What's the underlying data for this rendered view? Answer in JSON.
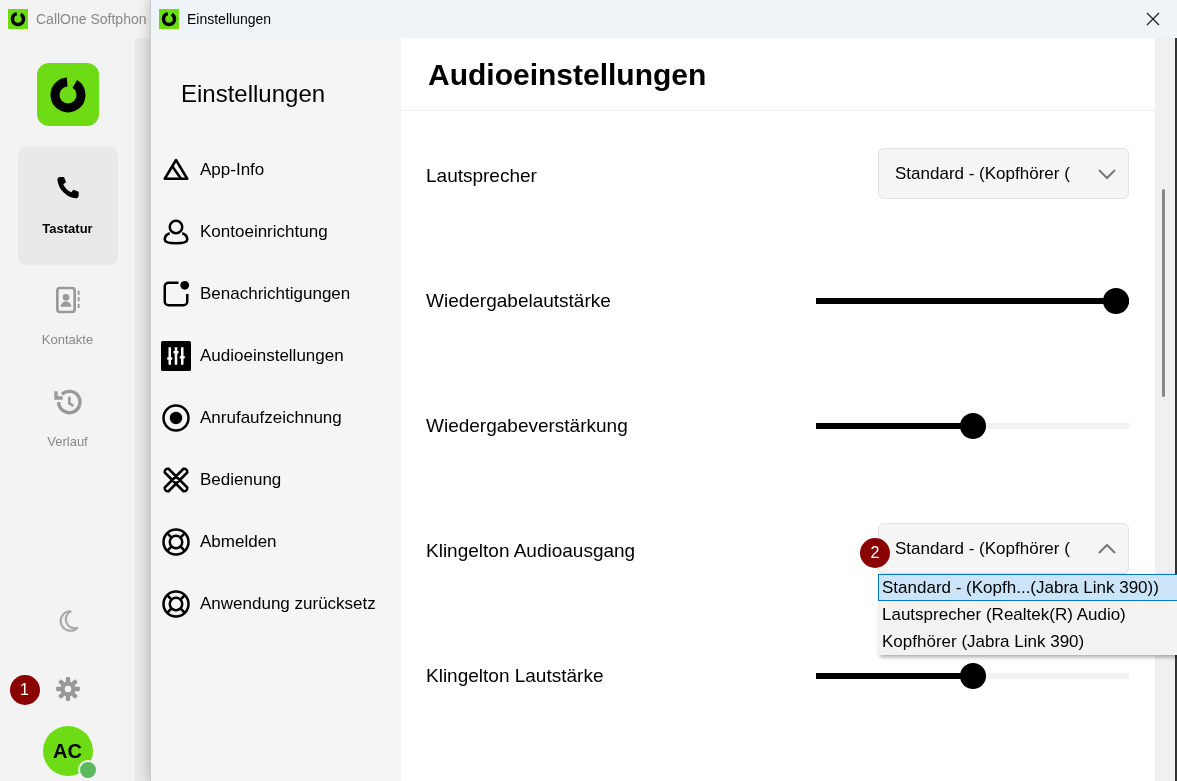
{
  "app_window": {
    "title": "CallOne Softphon",
    "nav": [
      {
        "label": "Tastatur",
        "selected": true
      },
      {
        "label": "Kontakte",
        "selected": false
      },
      {
        "label": "Verlauf",
        "selected": false
      }
    ],
    "settings_badge": "1",
    "avatar": {
      "initials": "AC"
    },
    "status_dot": {
      "color": "#5cb85c"
    }
  },
  "dialog": {
    "title": "Einstellungen",
    "sidebar": {
      "heading": "Einstellungen",
      "items": [
        {
          "label": "App-Info",
          "selected": false
        },
        {
          "label": "Kontoeinrichtung",
          "selected": false
        },
        {
          "label": "Benachrichtigungen",
          "selected": false
        },
        {
          "label": "Audioeinstellungen",
          "selected": true
        },
        {
          "label": "Anrufaufzeichnung",
          "selected": false
        },
        {
          "label": "Bedienung",
          "selected": false
        },
        {
          "label": "Abmelden",
          "selected": false
        },
        {
          "label": "Anwendung zurücksetz",
          "selected": false
        }
      ]
    },
    "page_title": "Audioeinstellungen",
    "rows": [
      {
        "kind": "select",
        "label": "Lautsprecher",
        "value": "Standard - (Kopfhörer (",
        "expanded": false
      },
      {
        "kind": "slider",
        "label": "Wiedergabelautstärke",
        "level": 1.0
      },
      {
        "kind": "slider",
        "label": "Wiedergabeverstärkung",
        "level": 0.5
      },
      {
        "kind": "select",
        "label": "Klingelton Audioausgang",
        "value": "Standard - (Kopfhörer (",
        "expanded": true,
        "badge": "2",
        "options": [
          {
            "label": "Standard - (Kopfh...(Jabra Link 390))",
            "selected": true
          },
          {
            "label": "Lautsprecher (Realtek(R) Audio)",
            "selected": false
          },
          {
            "label": "Kopfhörer (Jabra Link 390)",
            "selected": false
          }
        ]
      },
      {
        "kind": "slider",
        "label": "Klingelton Lautstärke",
        "level": 0.5
      }
    ]
  }
}
